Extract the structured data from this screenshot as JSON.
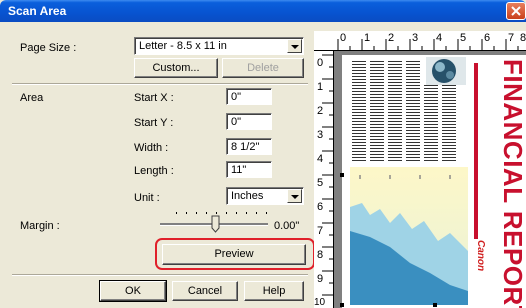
{
  "window": {
    "title": "Scan Area"
  },
  "page_size": {
    "label": "Page Size :",
    "label_underline": "P",
    "value": "Letter - 8.5 x 11 in"
  },
  "buttons": {
    "custom": "Custom...",
    "delete": "Delete",
    "preview": "Preview",
    "ok": "OK",
    "cancel": "Cancel",
    "help": "Help"
  },
  "area": {
    "label": "Area",
    "start_x": {
      "label": "Start X :",
      "value": "0\""
    },
    "start_y": {
      "label": "Start Y :",
      "value": "0\""
    },
    "width": {
      "label": "Width :",
      "value": "8 1/2\""
    },
    "length": {
      "label": "Length :",
      "value": "11\""
    },
    "unit": {
      "label": "Unit :",
      "value": "Inches"
    }
  },
  "margin": {
    "label": "Margin :",
    "value": "0.00\""
  },
  "preview": {
    "ruler_top": [
      "0",
      "1",
      "2",
      "3",
      "4",
      "5",
      "6",
      "7",
      "8"
    ],
    "ruler_left": [
      "0",
      "1",
      "2",
      "3",
      "4",
      "5",
      "6",
      "7",
      "8",
      "9",
      "10"
    ],
    "document_title": "FINANCIAL REPORT",
    "logo_text": "Canon"
  },
  "colors": {
    "titlebar": "#0853d0",
    "highlight": "#e0202a",
    "report_title": "#c8102e"
  }
}
